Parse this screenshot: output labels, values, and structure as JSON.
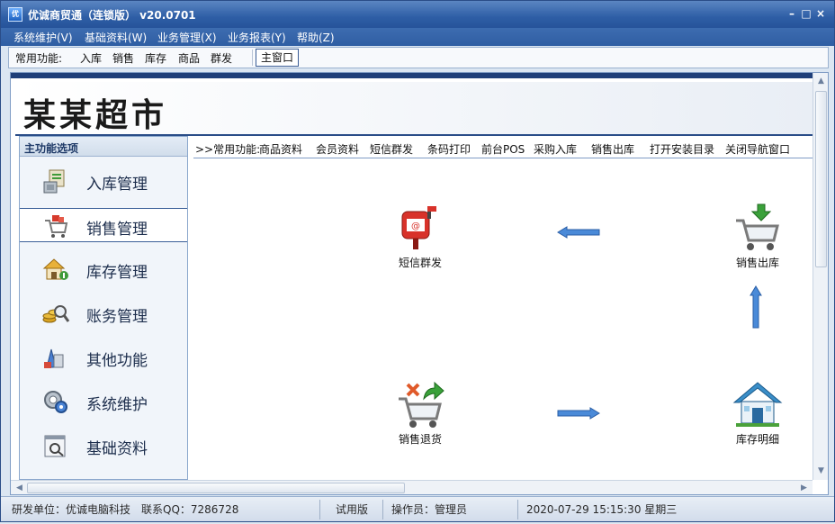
{
  "window": {
    "app_icon_text": "优",
    "title": "优诚商贸通（连锁版）  v20.0701",
    "minimize": "–",
    "maximize": "□",
    "close": "×"
  },
  "menu": [
    "系统维护(V)",
    "基础资料(W)",
    "业务管理(X)",
    "业务报表(Y)",
    "帮助(Z)"
  ],
  "toolbar": {
    "label": "常用功能:",
    "links": [
      "入库",
      "销售",
      "库存",
      "商品",
      "群发"
    ],
    "main_window": "主窗口"
  },
  "banner": {
    "store_name": "某某超市"
  },
  "sidebar": {
    "header": "主功能选项",
    "active_index": 1,
    "items": [
      {
        "label": "入库管理",
        "icon": "inbound-icon"
      },
      {
        "label": "销售管理",
        "icon": "sales-cart-icon"
      },
      {
        "label": "库存管理",
        "icon": "inventory-house-icon"
      },
      {
        "label": "账务管理",
        "icon": "accounts-coins-icon"
      },
      {
        "label": "其他功能",
        "icon": "other-tools-icon"
      },
      {
        "label": "系统维护",
        "icon": "system-gear-icon"
      },
      {
        "label": "基础资料",
        "icon": "basic-data-icon"
      }
    ]
  },
  "quickbar": {
    "label": ">>常用功能:",
    "links": [
      "商品资料",
      "会员资料",
      "短信群发",
      "条码打印",
      "前台POS",
      "采购入库",
      "销售出库",
      "打开安装目录",
      "关闭导航窗口"
    ]
  },
  "flow": {
    "nodes": [
      {
        "label": "短信群发",
        "icon": "sms-mailbox-icon"
      },
      {
        "label": "销售出库",
        "icon": "cart-out-icon"
      },
      {
        "label": "销售退货",
        "icon": "cart-return-icon"
      },
      {
        "label": "库存明细",
        "icon": "warehouse-house-icon"
      }
    ]
  },
  "status": {
    "developer": "研发单位：优诚电脑科技",
    "contact": "联系QQ：7286728",
    "edition": "试用版",
    "operator": "操作员：管理员",
    "datetime": "2020-07-29 15:15:30 星期三"
  }
}
